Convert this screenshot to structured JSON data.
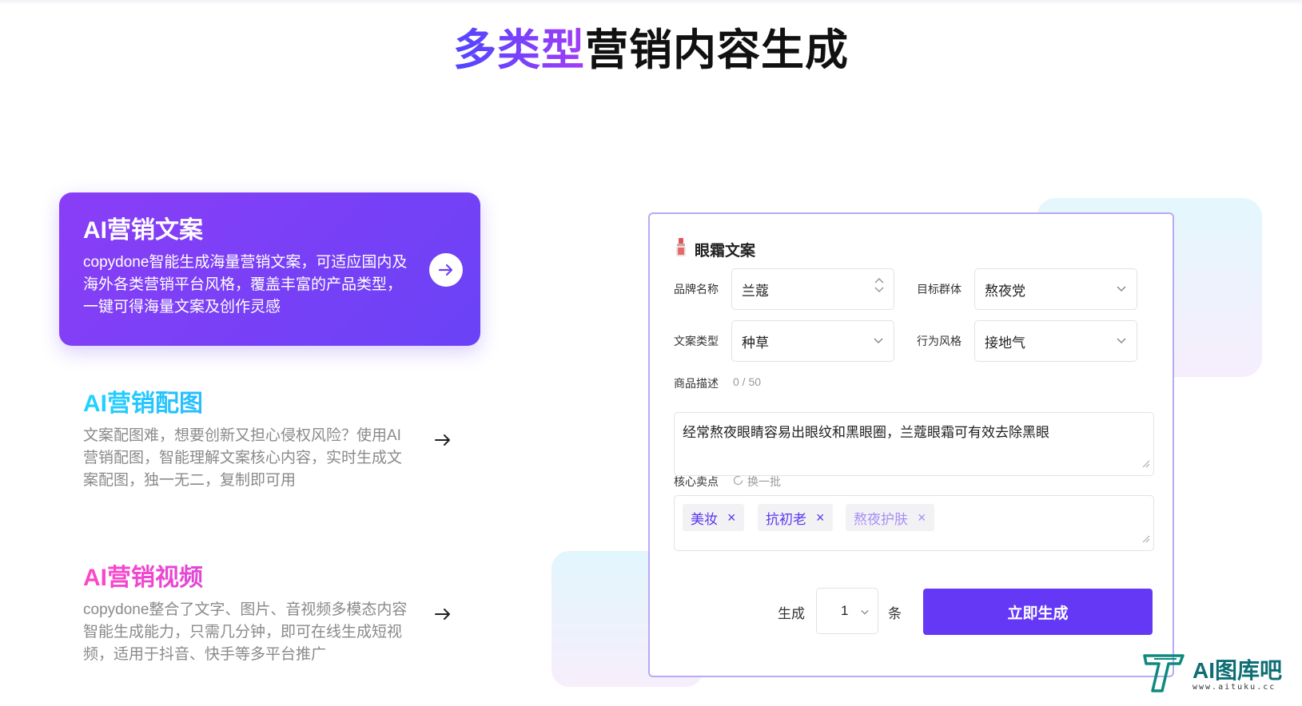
{
  "page_title": {
    "accent": "多类型",
    "rest": "营销内容生成"
  },
  "features": [
    {
      "title": "AI营销文案",
      "desc": "copydone智能生成海量营销文案，可适应国内及海外各类营销平台风格，覆盖丰富的产品类型，一键可得海量文案及创作灵感"
    },
    {
      "title": "AI营销配图",
      "desc": "文案配图难，想要创新又担心侵权风险？使用AI营销配图，智能理解文案核心内容，实时生成文案配图，独一无二，复制即可用"
    },
    {
      "title": "AI营销视频",
      "desc": "copydone整合了文字、图片、音视频多模态内容智能生成能力，只需几分钟，即可在线生成短视频，适用于抖音、快手等多平台推广"
    }
  ],
  "form": {
    "title": "眼霜文案",
    "brand_label": "品牌名称",
    "brand_value": "兰蔻",
    "audience_label": "目标群体",
    "audience_value": "熬夜党",
    "copy_type_label": "文案类型",
    "copy_type_value": "种草",
    "style_label": "行为风格",
    "style_value": "接地气",
    "desc_label": "商品描述",
    "desc_counter": "0 / 50",
    "desc_value": "经常熬夜眼睛容易出眼纹和黑眼圈，兰蔻眼霜可有效去除黑眼",
    "points_label": "核心卖点",
    "refresh_label": "换一批",
    "tags": [
      "美妆",
      "抗初老",
      "熬夜护肤"
    ],
    "tag_remove": "×",
    "generate_prefix": "生成",
    "count_value": "1",
    "generate_suffix": "条",
    "submit_label": "立即生成"
  },
  "watermark": {
    "name": "AI图库吧",
    "url": "www.aituku.cc"
  },
  "colors": {
    "primary": "#6438f5",
    "accent_gradient_start": "#8a3ef6",
    "panel_border": "#b7aaf6"
  }
}
